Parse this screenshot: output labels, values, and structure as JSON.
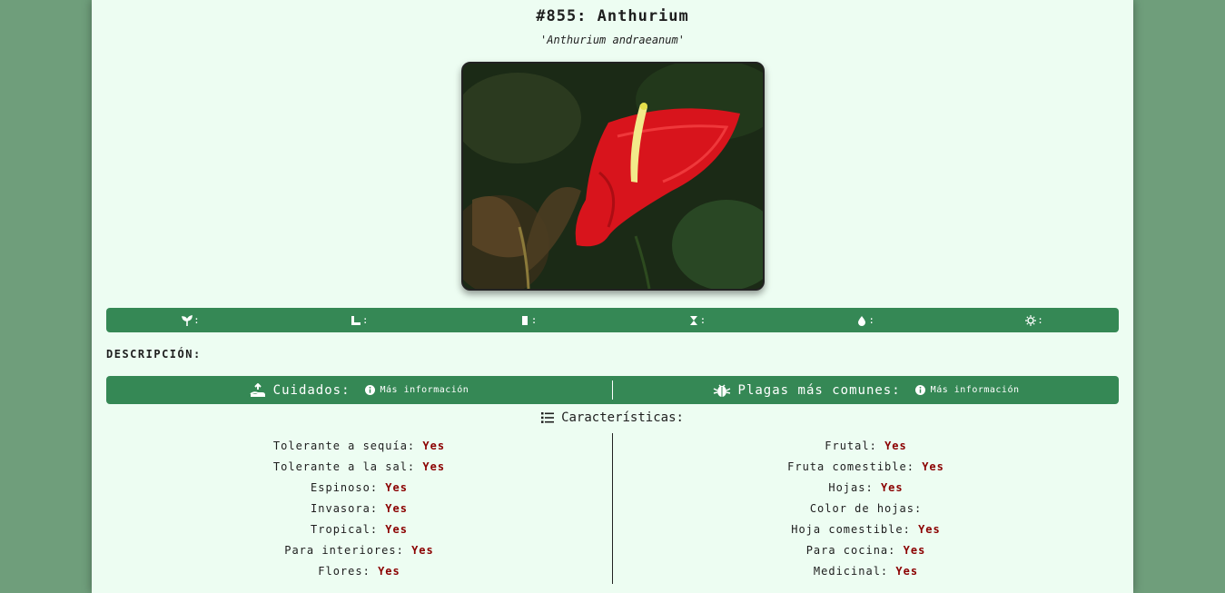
{
  "header": {
    "title": "#855: Anthurium",
    "scientific_name": "'Anthurium andraeanum'"
  },
  "image": {
    "alt": "Anthurium red flower photo"
  },
  "icon_bar": {
    "items": [
      {
        "icon": "sprout-icon",
        "value": ":"
      },
      {
        "icon": "ruler-icon",
        "value": ":"
      },
      {
        "icon": "door-icon",
        "value": ":"
      },
      {
        "icon": "hourglass-icon",
        "value": ":"
      },
      {
        "icon": "droplet-icon",
        "value": ":"
      },
      {
        "icon": "sun-icon",
        "value": ":"
      }
    ]
  },
  "description": {
    "label": "DESCRIPCIÓN:"
  },
  "care_bar": {
    "care_label": "Cuidados:",
    "care_more": "Más información",
    "pests_label": "Plagas más comunes:",
    "pests_more": "Más información"
  },
  "characteristics": {
    "title": "Características:",
    "left": [
      {
        "label": "Tolerante a sequía:",
        "value": "Yes"
      },
      {
        "label": "Tolerante a la sal:",
        "value": "Yes"
      },
      {
        "label": "Espinoso:",
        "value": "Yes"
      },
      {
        "label": "Invasora:",
        "value": "Yes"
      },
      {
        "label": "Tropical:",
        "value": "Yes"
      },
      {
        "label": "Para interiores:",
        "value": "Yes"
      },
      {
        "label": "Flores:",
        "value": "Yes"
      }
    ],
    "right": [
      {
        "label": "Frutal:",
        "value": "Yes"
      },
      {
        "label": "Fruta comestible:",
        "value": "Yes"
      },
      {
        "label": "Hojas:",
        "value": "Yes"
      },
      {
        "label": "Color de hojas:",
        "value": ""
      },
      {
        "label": "Hoja comestible:",
        "value": "Yes"
      },
      {
        "label": "Para cocina:",
        "value": "Yes"
      },
      {
        "label": "Medicinal:",
        "value": "Yes"
      }
    ]
  },
  "colors": {
    "accent": "#358855",
    "background": "#6f9e7b",
    "card": "#edfdf2",
    "value": "#8b0000"
  }
}
